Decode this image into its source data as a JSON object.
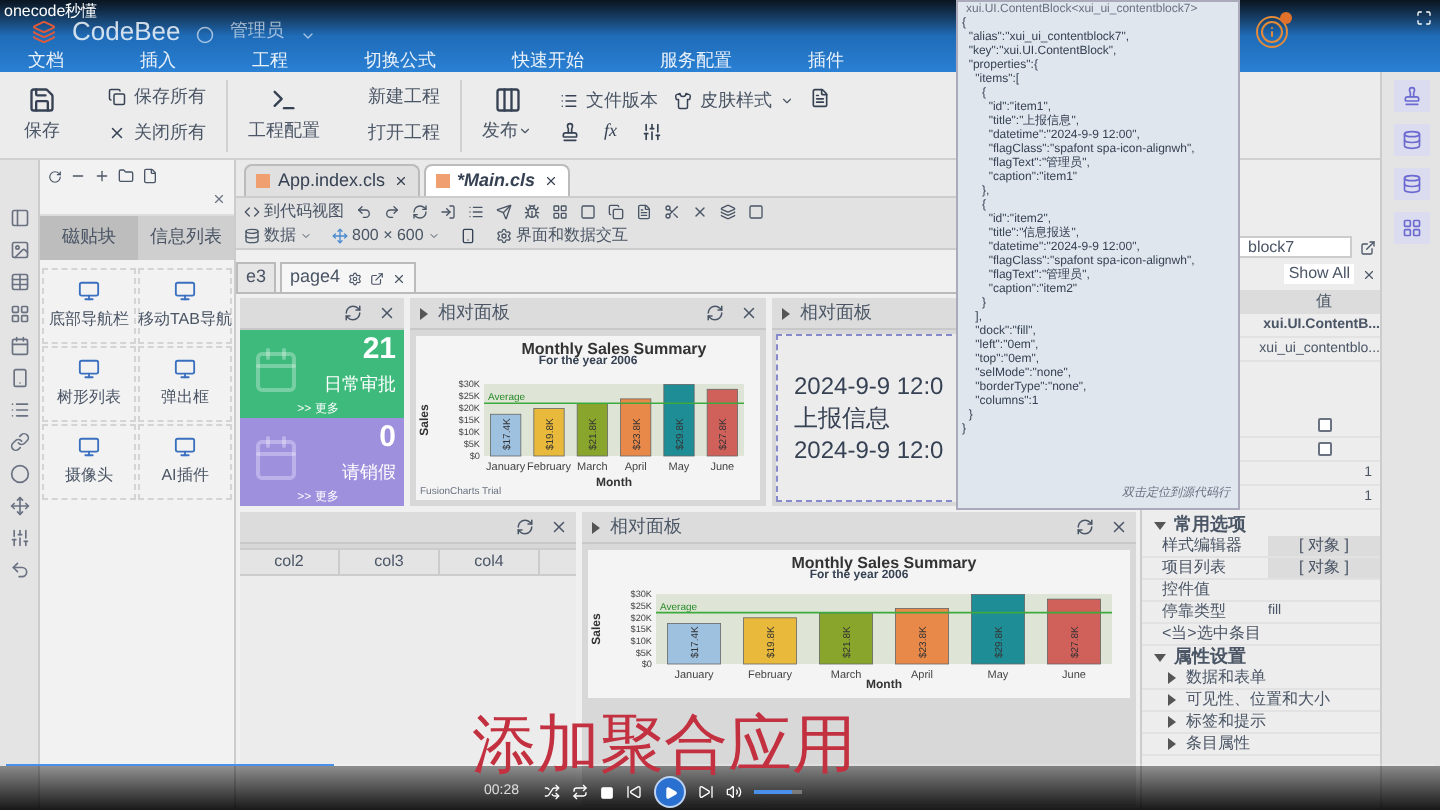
{
  "overlay_label": "onecode秒懂",
  "app": {
    "name": "CodeBee",
    "user": "管理员"
  },
  "menu": [
    "文档",
    "插入",
    "工程",
    "切换公式",
    "快速开始",
    "服务配置",
    "插件"
  ],
  "ribbon": {
    "formula": "fx",
    "save": "保存",
    "save_all": "保存所有",
    "close_all": "关闭所有",
    "project_config": "工程配置",
    "new_project": "新建工程",
    "open_project": "打开工程",
    "publish": "发布",
    "file_version": "文件版本",
    "skin": "皮肤样式"
  },
  "left_panel": {
    "tabs": [
      {
        "label": "磁贴块",
        "selected": true
      },
      {
        "label": "信息列表",
        "selected": false
      }
    ],
    "items": [
      "底部导航栏",
      "移动TAB导航",
      "树形列表",
      "弹出框",
      "摄像头",
      "AI插件"
    ]
  },
  "editor_tabs": [
    {
      "label": "App.index.cls",
      "selected": false
    },
    {
      "label": "*Main.cls",
      "selected": true
    }
  ],
  "editor_toolbar": {
    "code_view": "到代码视图",
    "data": "数据",
    "size": "800 × 600",
    "interaction": "界面和数据交互"
  },
  "page_tabs": [
    {
      "label": "e3",
      "selected": false
    },
    {
      "label": "page4",
      "selected": true
    }
  ],
  "tiles": [
    {
      "count": "21",
      "label": "日常审批",
      "more": ">> 更多",
      "color": "#3dba7c"
    },
    {
      "count": "0",
      "label": "请销假",
      "more": ">> 更多",
      "color": "#9f90de"
    }
  ],
  "chart_panel": {
    "title": "相对面板",
    "subtitle": "For the year 2006",
    "footer": "FusionCharts Trial",
    "chart_data": {
      "type": "bar",
      "title": "Monthly Sales Summary",
      "xlabel": "Month",
      "ylabel": "Sales",
      "categories": [
        "January",
        "February",
        "March",
        "April",
        "May",
        "June"
      ],
      "series": [
        {
          "values": [
            17.4,
            19.8,
            21.8,
            23.8,
            29.8,
            27.8
          ]
        }
      ],
      "ylim": [
        0,
        30
      ],
      "yticks": [
        {
          "value": 0,
          "label": "$0"
        },
        {
          "value": 5,
          "label": "$5K"
        },
        {
          "value": 10,
          "label": "$10K"
        },
        {
          "value": 15,
          "label": "$15K"
        },
        {
          "value": 20,
          "label": "$20K"
        },
        {
          "value": 25,
          "label": "$25K"
        },
        {
          "value": 30,
          "label": "$30K"
        }
      ],
      "value_labels": [
        "$17.4K",
        "$19.8K",
        "$21.8K",
        "$23.8K",
        "$29.8K",
        "$27.8K"
      ],
      "ref_lines": [
        {
          "axis": "y",
          "value": 22,
          "label": "Average"
        }
      ]
    }
  },
  "info_panel": {
    "title": "相对面板",
    "lines": [
      "2024-9-9 12:0",
      "上报信息",
      "2024-9-9 12:0"
    ]
  },
  "grid_panel": {
    "columns": [
      "col2",
      "col3",
      "col4"
    ]
  },
  "chart_panel_2": {
    "title": "相对面板",
    "subtitle": "For the year 2006",
    "chart_data": {
      "type": "bar",
      "title": "Monthly Sales Summary",
      "xlabel": "Month",
      "ylabel": "Sales",
      "categories": [
        "January",
        "February",
        "March",
        "April",
        "May",
        "June"
      ],
      "series": [
        {
          "values": [
            17.4,
            19.8,
            21.8,
            23.8,
            29.8,
            27.8
          ]
        }
      ],
      "ylim": [
        0,
        30
      ],
      "yticks": [
        {
          "value": 0,
          "label": "$0"
        },
        {
          "value": 5,
          "label": "$5K"
        },
        {
          "value": 10,
          "label": "$10K"
        },
        {
          "value": 15,
          "label": "$15K"
        },
        {
          "value": 20,
          "label": "$20K"
        },
        {
          "value": 25,
          "label": "$25K"
        },
        {
          "value": 30,
          "label": "$30K"
        }
      ],
      "value_labels": [
        "$17.4K",
        "$19.8K",
        "$21.8K",
        "$23.8K",
        "$29.8K",
        "$27.8K"
      ],
      "ref_lines": [
        {
          "axis": "y",
          "value": 22,
          "label": "Average"
        }
      ]
    }
  },
  "json_popup": {
    "title": "xui.UI.ContentBlock<xui_ui_contentblock7>",
    "hint": "双击定位到源代码行",
    "lines": [
      "{",
      "  \"alias\":\"xui_ui_contentblock7\",",
      "  \"key\":\"xui.UI.ContentBlock\",",
      "  \"properties\":{",
      "    \"items\":[",
      "      {",
      "        \"id\":\"item1\",",
      "        \"title\":\"上报信息\",",
      "        \"datetime\":\"2024-9-9 12:00\",",
      "        \"flagClass\":\"spafont spa-icon-alignwh\",",
      "        \"flagText\":\"管理员\",",
      "        \"caption\":\"item1\"",
      "      },",
      "      {",
      "        \"id\":\"item2\",",
      "        \"title\":\"信息报送\",",
      "        \"datetime\":\"2024-9-9 12:00\",",
      "        \"flagClass\":\"spafont spa-icon-alignwh\",",
      "        \"flagText\":\"管理员\",",
      "        \"caption\":\"item2\"",
      "      }",
      "    ],",
      "    \"dock\":\"fill\",",
      "    \"left\":\"0em\",",
      "    \"top\":\"0em\",",
      "    \"selMode\":\"none\",",
      "    \"borderType\":\"none\",",
      "    \"columns\":1",
      "  }",
      "}"
    ]
  },
  "properties": {
    "search": "block7",
    "filter_button": "Show All",
    "value_header": "值",
    "rows": [
      {
        "kind": "text",
        "value": "xui.UI.ContentB..."
      },
      {
        "kind": "text",
        "value": "xui_ui_contentblo..."
      },
      {
        "kind": "checkbox",
        "checked": false
      },
      {
        "kind": "checkbox",
        "checked": false
      },
      {
        "kind": "text",
        "value": "1"
      },
      {
        "kind": "text",
        "value": "1"
      }
    ],
    "common": {
      "title": "常用选项",
      "expanded": true,
      "rows": [
        {
          "label": "样式编辑器",
          "value": "[ 对象 ]",
          "kind": "object"
        },
        {
          "label": "项目列表",
          "value": "[ 对象 ]",
          "kind": "object"
        },
        {
          "label": "控件值",
          "kind": "text"
        },
        {
          "label": "停靠类型",
          "value": "fill",
          "kind": "text"
        },
        {
          "label": "<当>选中条目",
          "kind": "text"
        }
      ]
    },
    "settings": {
      "title": "属性设置",
      "expanded": true,
      "groups": [
        "数据和表单",
        "可见性、位置和大小",
        "标签和提示",
        "条目属性"
      ]
    }
  },
  "player": {
    "time": "00:28",
    "subtitle": "添加聚合应用",
    "progress": {
      "level": 0.23
    },
    "volume": {
      "level": 0.8
    }
  }
}
